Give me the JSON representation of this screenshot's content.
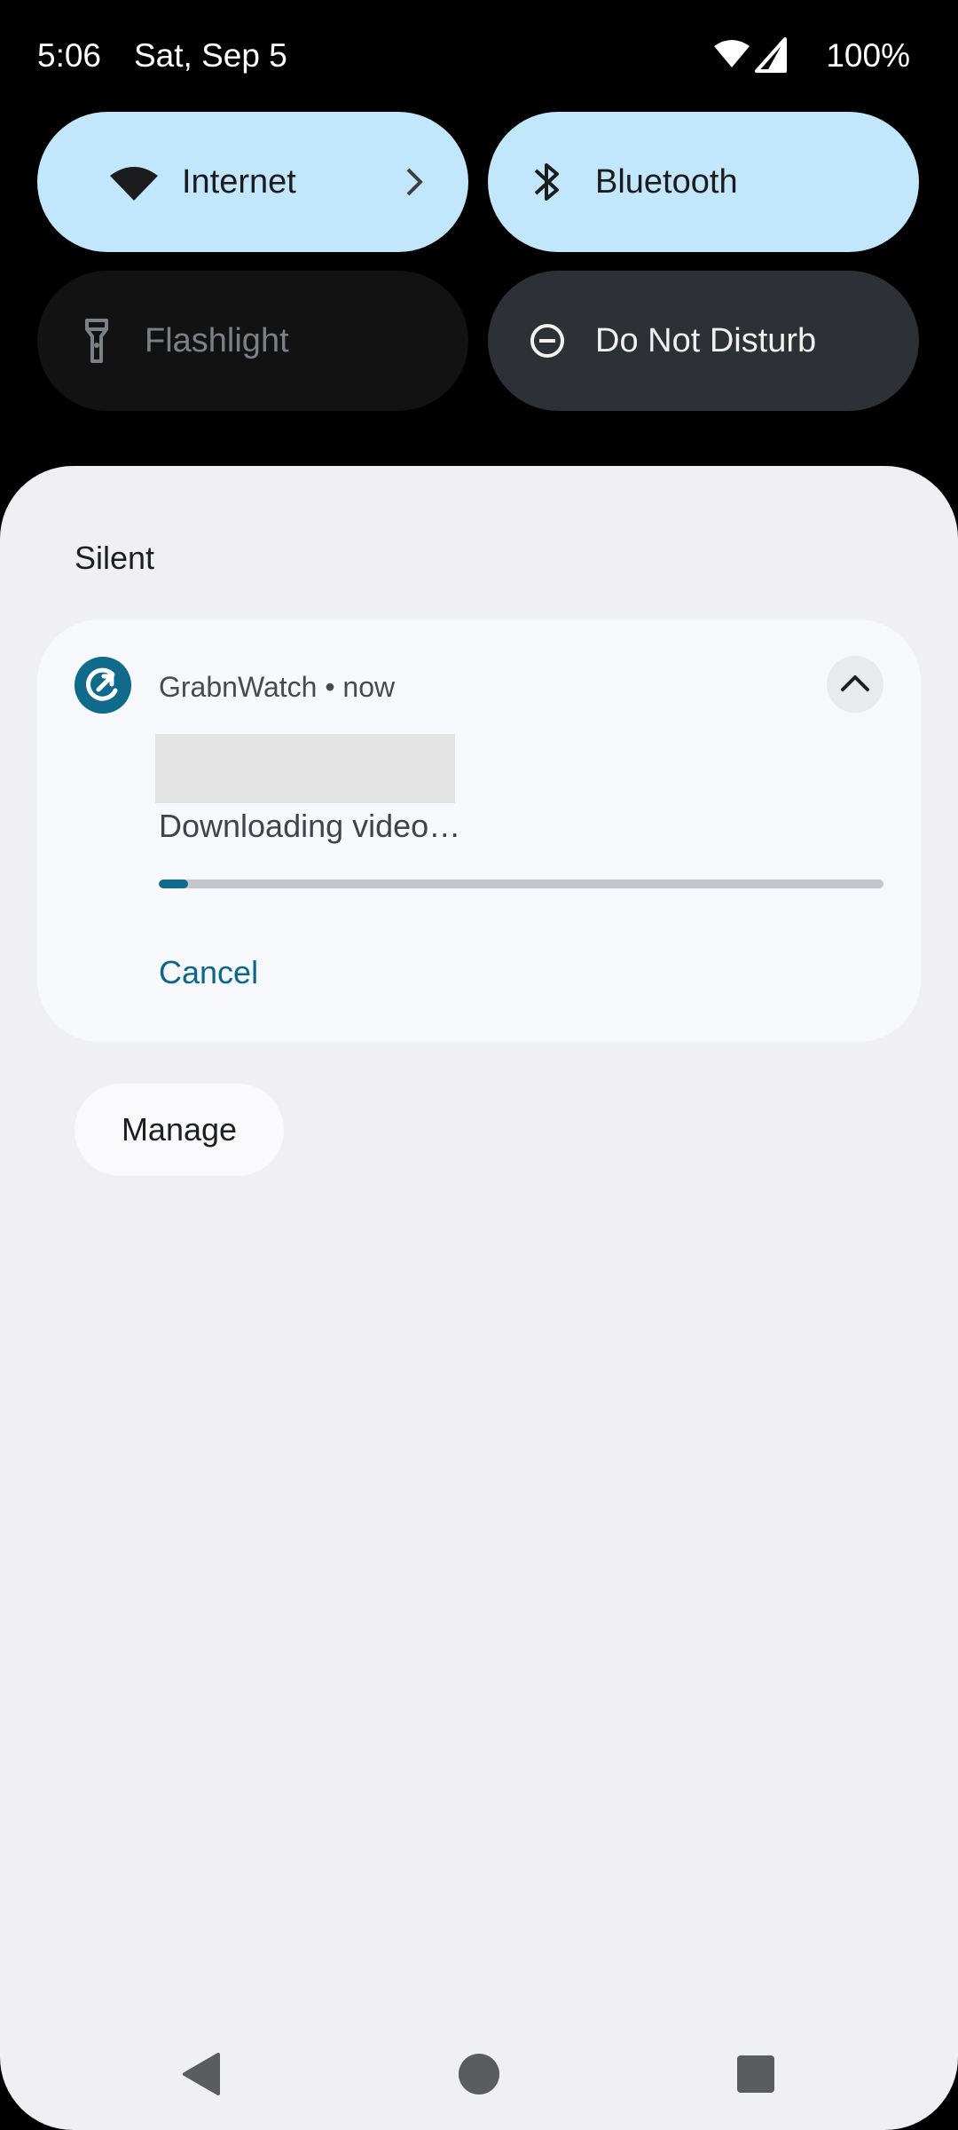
{
  "status_bar": {
    "time": "5:06",
    "date": "Sat, Sep 5",
    "battery": "100%",
    "icons": [
      "wifi-icon",
      "cell-signal-icon"
    ]
  },
  "quick_settings": {
    "tiles": [
      {
        "label": "Internet",
        "icon": "wifi-icon",
        "state": "on",
        "has_chevron": true
      },
      {
        "label": "Bluetooth",
        "icon": "bluetooth-icon",
        "state": "on"
      },
      {
        "label": "Flashlight",
        "icon": "flashlight-icon",
        "state": "off"
      },
      {
        "label": "Do Not Disturb",
        "icon": "do-not-disturb-icon",
        "state": "off"
      }
    ]
  },
  "notifications": {
    "section_title": "Silent",
    "items": [
      {
        "app_name": "GrabnWatch • now",
        "app_icon": "grabnwatch-app-icon",
        "text": "Downloading video…",
        "progress": 0.04,
        "action": "Cancel",
        "expand_icon": "chevron-up-icon"
      }
    ],
    "manage_label": "Manage"
  },
  "nav_bar": {
    "icons": [
      "back-icon",
      "home-icon",
      "recents-icon"
    ]
  },
  "colors": {
    "tile_active": "#c2e7fc",
    "tile_off": "#121212",
    "tile_dnd": "#2d3034",
    "shade_background": "#f0f0f2",
    "accent": "#0f6a8c"
  }
}
